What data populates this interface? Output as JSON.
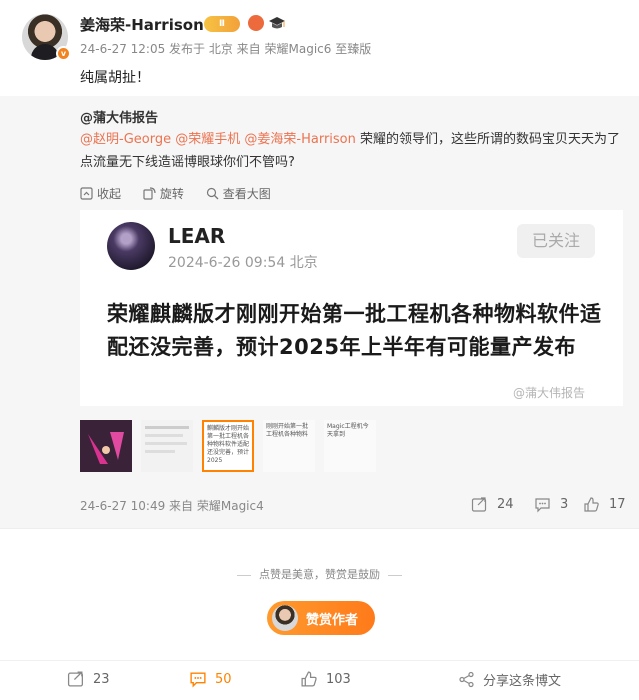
{
  "post": {
    "username": "姜海荣-Harrison",
    "level_badge": "Ⅱ",
    "verified_badge": "v",
    "meta": "24-6-27 12:05 发布于 北京 来自 荣耀Magic6 至臻版",
    "text": "纯属胡扯！"
  },
  "repost": {
    "author": "@蒲大伟报告",
    "mentions": [
      "@赵明-George",
      "@荣耀手机",
      "@姜海荣-Harrison"
    ],
    "text_rest": " 荣耀的领导们，这些所谓的数码宝贝天天为了点流量无下线造谣博眼球你们不管吗?",
    "toolbar": {
      "collapse": "收起",
      "rotate": "旋转",
      "view_large": "查看大图"
    },
    "image_card": {
      "name": "LEAR",
      "date": "2024-6-26 09:54 北京",
      "follow": "已关注",
      "body": "荣耀麒麟版才刚刚开始第一批工程机各种物料软件适配还没完善，预计2025年上半年有可能量产发布",
      "watermark": "@蒲大伟报告"
    },
    "thumbnails": [
      {
        "text": ""
      },
      {
        "text": ""
      },
      {
        "text": "麒麟版才刚开始第一批工程机各种物料软件适配还没完善，预计2025"
      },
      {
        "text": "刚刚开始第一批工程机各种物料"
      },
      {
        "text": "Magic工程机今天拿到"
      }
    ],
    "meta": "24-6-27 10:49 来自 荣耀Magic4",
    "actions": {
      "repost_count": "24",
      "comment_count": "3",
      "like_count": "17"
    }
  },
  "reward": {
    "caption": "点赞是美意，赞赏是鼓励",
    "button": "赞赏作者"
  },
  "bottom_bar": {
    "repost_count": "23",
    "comment_count": "50",
    "like_count": "103",
    "share_label": "分享这条博文"
  },
  "colors": {
    "accent": "#ff8200",
    "mention": "#eb7350",
    "repost_bg": "#f6f6f6"
  }
}
